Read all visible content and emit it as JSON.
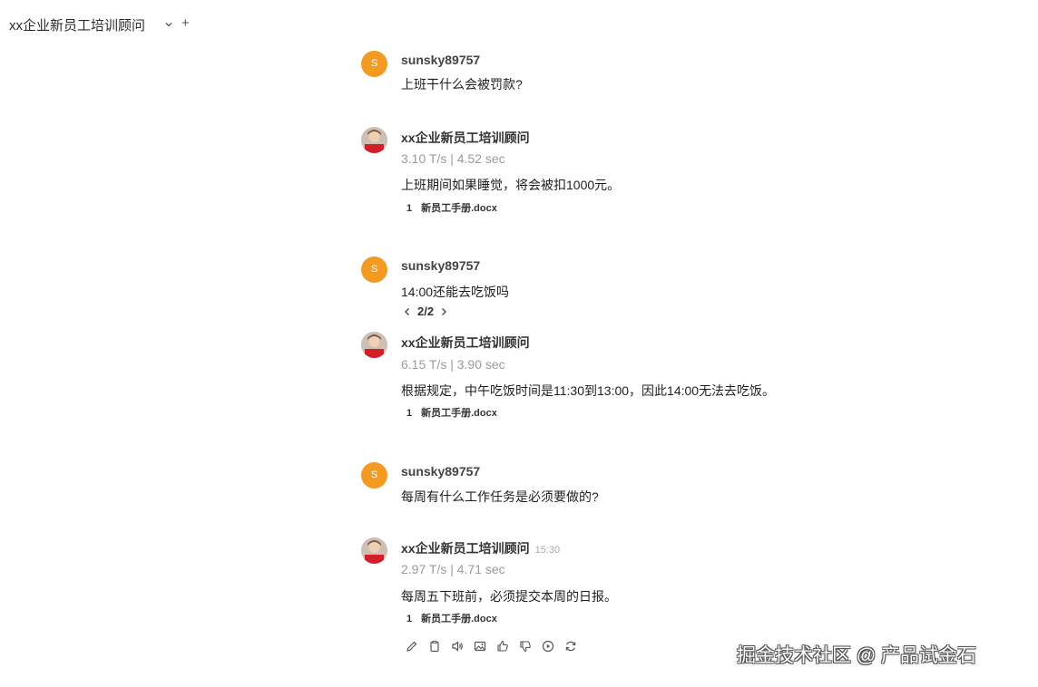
{
  "header": {
    "title": "xx企业新员工培训顾问",
    "add_symbol": "+"
  },
  "conversation": [
    {
      "role": "user",
      "avatar_letter": "S",
      "name": "sunsky89757",
      "text": "上班干什么会被罚款?"
    },
    {
      "role": "bot",
      "name": "xx企业新员工培训顾问",
      "time": "",
      "stats": "3.10 T/s | 4.52 sec",
      "text": "上班期间如果睡觉，将会被扣1000元。",
      "citation": {
        "num": "1",
        "file": "新员工手册.docx"
      }
    },
    {
      "role": "user",
      "avatar_letter": "S",
      "name": "sunsky89757",
      "text": "14:00还能去吃饭吗",
      "pager": "2/2"
    },
    {
      "role": "bot",
      "name": "xx企业新员工培训顾问",
      "time": "",
      "stats": "6.15 T/s | 3.90 sec",
      "text": "根据规定，中午吃饭时间是11:30到13:00，因此14:00无法去吃饭。",
      "citation": {
        "num": "1",
        "file": "新员工手册.docx"
      }
    },
    {
      "role": "user",
      "avatar_letter": "S",
      "name": "sunsky89757",
      "text": "每周有什么工作任务是必须要做的?"
    },
    {
      "role": "bot",
      "name": "xx企业新员工培训顾问",
      "time": "15:30",
      "stats": "2.97 T/s | 4.71 sec",
      "text": "每周五下班前，必须提交本周的日报。",
      "citation": {
        "num": "1",
        "file": "新员工手册.docx"
      }
    }
  ],
  "action_icons": [
    "edit-icon",
    "copy-icon",
    "speaker-icon",
    "image-icon",
    "thumbs-up-icon",
    "thumbs-down-icon",
    "play-icon",
    "regenerate-icon"
  ],
  "watermark": "掘金技术社区 @ 产品试金石",
  "colors": {
    "user_avatar": "#f29a21",
    "stats_text": "#9a9a9a"
  }
}
